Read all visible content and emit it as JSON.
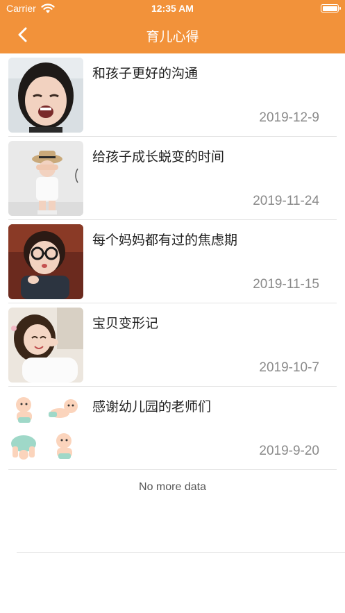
{
  "status_bar": {
    "carrier": "Carrier",
    "time": "12:35 AM"
  },
  "nav": {
    "title": "育儿心得",
    "back_icon": "chevron-left-icon"
  },
  "articles": [
    {
      "title": "和孩子更好的沟通",
      "date": "2019-12-9",
      "image": "crying-girl-photo"
    },
    {
      "title": "给孩子成长蜕变的时间",
      "date": "2019-11-24",
      "image": "child-with-hat-photo"
    },
    {
      "title": "每个妈妈都有过的焦虑期",
      "date": "2019-11-15",
      "image": "girl-with-glasses-photo"
    },
    {
      "title": "宝贝变形记",
      "date": "2019-10-7",
      "image": "smiling-girl-photo"
    },
    {
      "title": "感谢幼儿园的老师们",
      "date": "2019-9-20",
      "image": "cartoon-babies-illustration"
    }
  ],
  "footer": {
    "no_more": "No more data"
  },
  "colors": {
    "accent": "#F2923A",
    "date": "#8a8a8a",
    "separator": "#e2e2e2"
  }
}
